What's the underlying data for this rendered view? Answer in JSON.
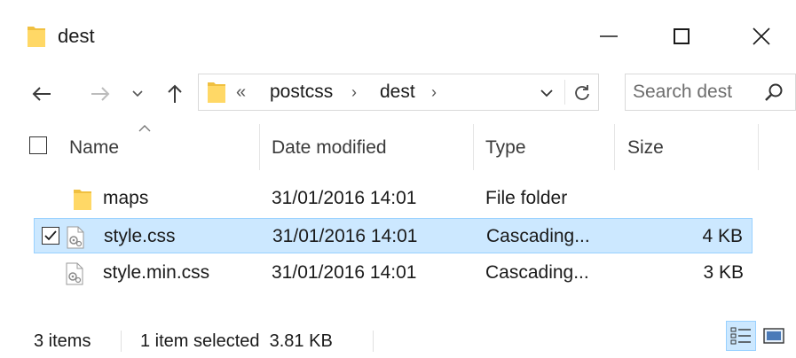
{
  "window": {
    "title": "dest",
    "controls": {
      "minimize_icon": "minimize-icon",
      "maximize_icon": "maximize-icon",
      "close_icon": "close-icon"
    }
  },
  "navigation": {
    "back_icon": "back-arrow-icon",
    "forward_icon": "forward-arrow-icon",
    "recent_icon": "chevron-down-icon",
    "up_icon": "up-arrow-icon"
  },
  "address_bar": {
    "overflow_prefix": "«",
    "breadcrumbs": [
      "postcss",
      "dest"
    ],
    "separator": "›"
  },
  "search": {
    "placeholder": "Search dest"
  },
  "columns": [
    {
      "label": "Name",
      "sorted": "ascending"
    },
    {
      "label": "Date modified"
    },
    {
      "label": "Type"
    },
    {
      "label": "Size"
    }
  ],
  "files": [
    {
      "name": "maps",
      "date": "31/01/2016 14:01",
      "type": "File folder",
      "size": "",
      "icon": "folder-icon",
      "selected": false
    },
    {
      "name": "style.css",
      "date": "31/01/2016 14:01",
      "type": "Cascading...",
      "size": "4 KB",
      "icon": "css-file-icon",
      "selected": true
    },
    {
      "name": "style.min.css",
      "date": "31/01/2016 14:01",
      "type": "Cascading...",
      "size": "3 KB",
      "icon": "css-file-icon",
      "selected": false
    }
  ],
  "status_bar": {
    "item_count": "3 items",
    "selection": "1 item selected  3.81 KB",
    "active_view": "details"
  },
  "colors": {
    "folder": "#ffd866",
    "selection_bg": "#cce8ff",
    "selection_border": "#99d1ff"
  }
}
